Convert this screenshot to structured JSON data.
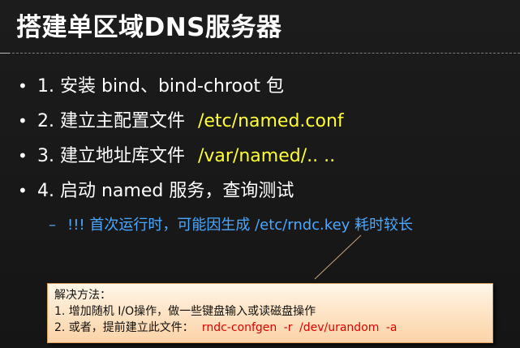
{
  "slide": {
    "title": "搭建单区域DNS服务器",
    "bullets": [
      {
        "text": "1. 安装 bind、bind-chroot 包",
        "highlight": ""
      },
      {
        "text": "2. 建立主配置文件",
        "highlight": "/etc/named.conf"
      },
      {
        "text": "3. 建立地址库文件",
        "highlight": "/var/named/.. .."
      },
      {
        "text": "4. 启动 named 服务，查询测试",
        "highlight": ""
      }
    ],
    "sub_bullet": {
      "dash": "–",
      "text": "!!! 首次运行时，可能因生成 /etc/rndc.key 耗时较长"
    },
    "callout": {
      "heading": "解决方法：",
      "line1": "1. 增加随机 I/O操作，做一些键盘输入或读磁盘操作",
      "line2_prefix": "2. 或者，提前建立此文件：",
      "line2_command": "rndc-confgen -r /dev/urandom -a"
    }
  },
  "colors": {
    "background": "#1b1b1b",
    "title": "#ffffff",
    "highlight": "#ffff33",
    "sub_bullet": "#4aa8ff",
    "callout_command": "#e10000"
  }
}
